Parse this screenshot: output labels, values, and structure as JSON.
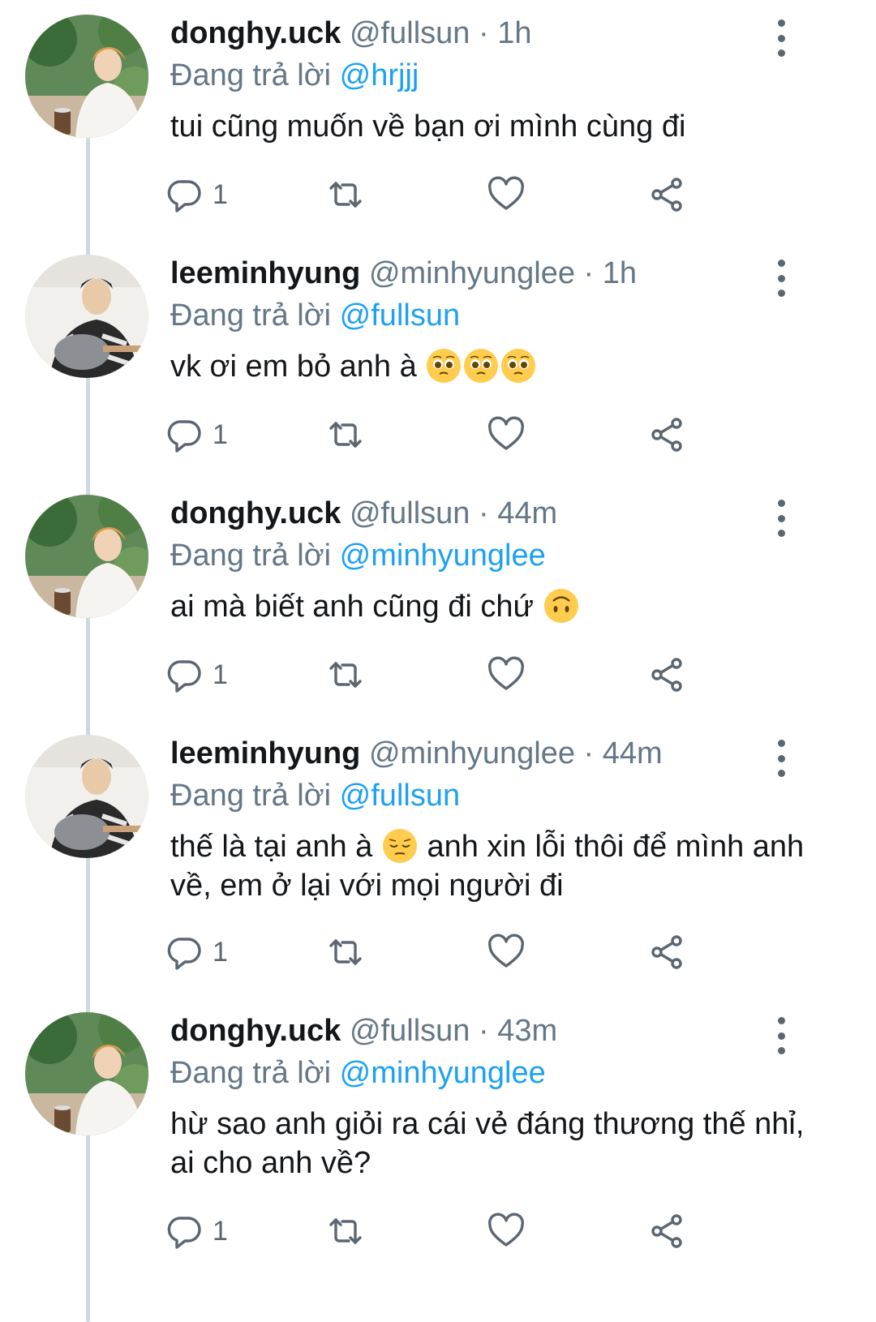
{
  "reply_prefix": "Đang trả lời",
  "tweets": [
    {
      "name": "donghy.uck",
      "handle": "@fullsun",
      "time": "1h",
      "reply_to": "@hrjjj",
      "text_before": "tui cũng muốn về bạn ơi mình cùng đi",
      "emojis": [],
      "text_after": "",
      "reply_count": "1",
      "avatar": "orange-hair-person"
    },
    {
      "name": "leeminhyung",
      "handle": "@minhyunglee",
      "time": "1h",
      "reply_to": "@fullsun",
      "text_before": "vk ơi em bỏ anh à",
      "emojis": [
        "pleading-face",
        "pleading-face",
        "pleading-face"
      ],
      "text_after": "",
      "reply_count": "1",
      "avatar": "guitar-person"
    },
    {
      "name": "donghy.uck",
      "handle": "@fullsun",
      "time": "44m",
      "reply_to": "@minhyunglee",
      "text_before": "ai mà biết anh cũng đi chứ",
      "emojis": [
        "upside-down-face"
      ],
      "text_after": "",
      "reply_count": "1",
      "avatar": "orange-hair-person"
    },
    {
      "name": "leeminhyung",
      "handle": "@minhyunglee",
      "time": "44m",
      "reply_to": "@fullsun",
      "text_before": "thế là tại anh à",
      "emojis": [
        "pensive-face"
      ],
      "text_after": "anh xin lỗi thôi để mình anh về, em ở lại với mọi người đi",
      "reply_count": "1",
      "avatar": "guitar-person"
    },
    {
      "name": "donghy.uck",
      "handle": "@fullsun",
      "time": "43m",
      "reply_to": "@minhyunglee",
      "text_before": "hừ sao anh giỏi ra cái vẻ đáng thương thế nhỉ, ai cho anh về?",
      "emojis": [],
      "text_after": "",
      "reply_count": "1",
      "avatar": "orange-hair-person"
    }
  ],
  "colors": {
    "text": "#14171a",
    "secondary": "#657786",
    "mention": "#1da1f2",
    "thread_line": "#cfd9de",
    "icon": "#5b6670"
  },
  "icons": [
    "reply-icon",
    "retweet-icon",
    "like-icon",
    "share-icon",
    "more-icon"
  ]
}
